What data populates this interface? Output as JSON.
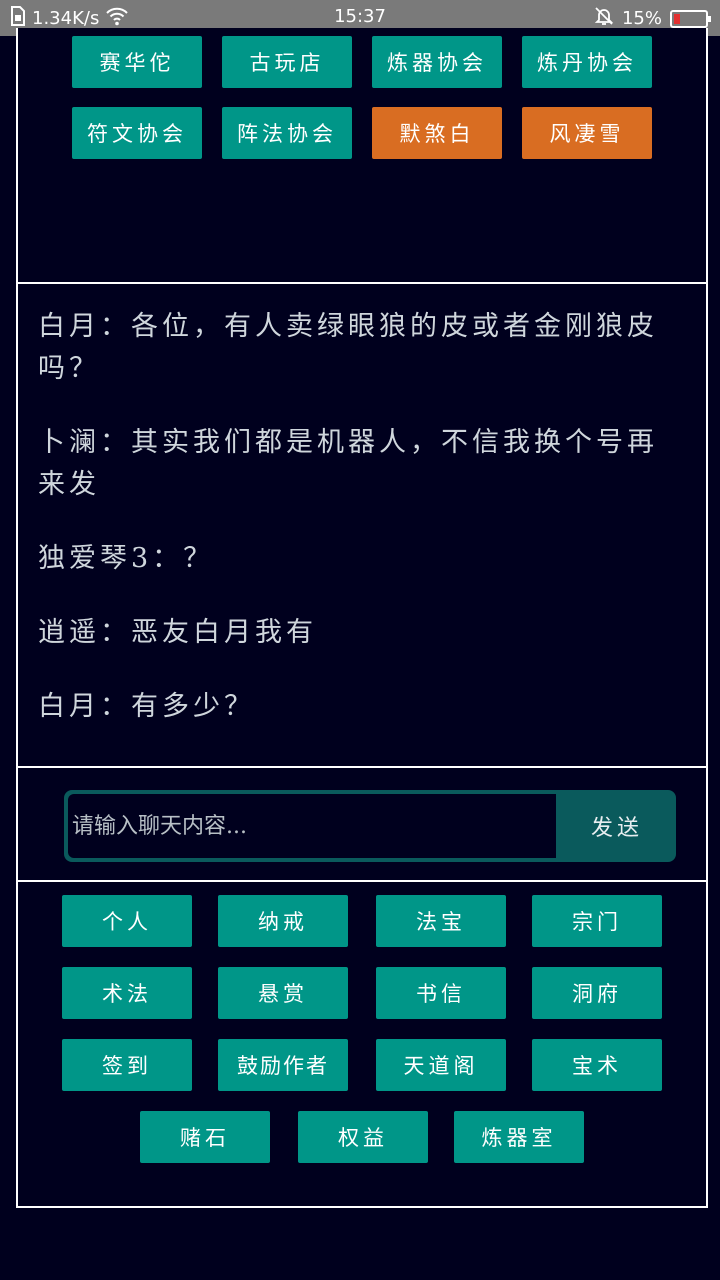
{
  "status": {
    "speed": "1.34K/s",
    "time": "15:37",
    "battery": "15%",
    "battery_level": 0.15
  },
  "top_buttons": [
    {
      "label": "赛华佗",
      "color": "#009688"
    },
    {
      "label": "古玩店",
      "color": "#009688"
    },
    {
      "label": "炼器协会",
      "color": "#009688"
    },
    {
      "label": "炼丹协会",
      "color": "#009688"
    },
    {
      "label": "符文协会",
      "color": "#009688"
    },
    {
      "label": "阵法协会",
      "color": "#009688"
    },
    {
      "label": "默煞白",
      "color": "#d96d22"
    },
    {
      "label": "风凄雪",
      "color": "#d96d22"
    }
  ],
  "chat": {
    "messages": [
      "白月：各位，有人卖绿眼狼的皮或者金刚狼皮吗？",
      "卜澜：其实我们都是机器人，不信我换个号再来发",
      "独爱琴3：？",
      "逍遥：恶友白月我有",
      "白月：有多少？"
    ]
  },
  "input": {
    "placeholder": "请输入聊天内容...",
    "send_label": "发送"
  },
  "menu_buttons": [
    {
      "label": "个人"
    },
    {
      "label": "纳戒"
    },
    {
      "label": "法宝"
    },
    {
      "label": "宗门"
    },
    {
      "label": "术法"
    },
    {
      "label": "悬赏"
    },
    {
      "label": "书信"
    },
    {
      "label": "洞府"
    },
    {
      "label": "签到"
    },
    {
      "label": "鼓励作者"
    },
    {
      "label": "天道阁"
    },
    {
      "label": "宝术"
    },
    {
      "label": "赌石"
    },
    {
      "label": "权益"
    },
    {
      "label": "炼器室"
    }
  ],
  "colors": {
    "background": "#00001e",
    "teal": "#009688",
    "orange": "#d96d22"
  }
}
